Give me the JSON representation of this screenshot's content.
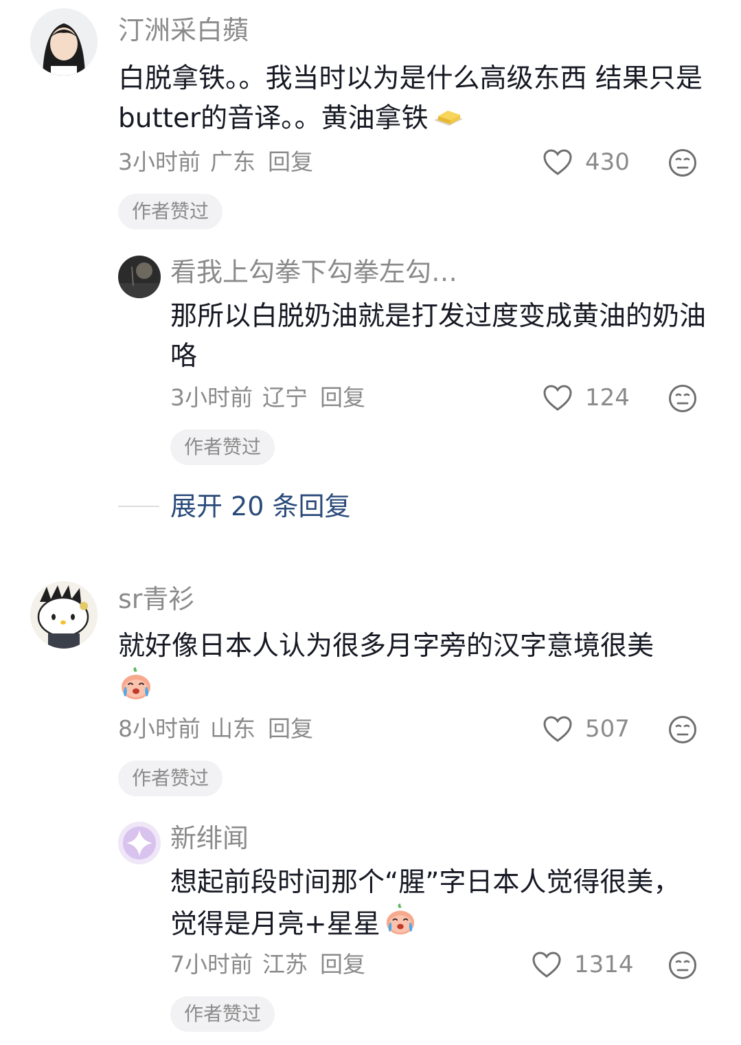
{
  "comments": [
    {
      "username": "汀洲采白蘋",
      "text": "白脱拿铁。。我当时以为是什么高级东西 结果只是butter的音译。。黄油拿铁",
      "time": "3小时前",
      "location": "广东",
      "reply_label": "回复",
      "likes": "430",
      "badge": "作者赞过",
      "reply": {
        "username": "看我上勾拳下勾拳左勾…",
        "text": "那所以白脱奶油就是打发过度变成黄油的奶油咯",
        "time": "3小时前",
        "location": "辽宁",
        "reply_label": "回复",
        "likes": "124",
        "badge": "作者赞过"
      },
      "expand_label": "展开 20 条回复"
    },
    {
      "username": "sr青衫",
      "text": "就好像日本人认为很多月字旁的汉字意境很美",
      "time": "8小时前",
      "location": "山东",
      "reply_label": "回复",
      "likes": "507",
      "badge": "作者赞过",
      "reply": {
        "username": "新绯闻",
        "text": "想起前段时间那个“腥”字日本人觉得很美，觉得是月亮+星星",
        "time": "7小时前",
        "location": "江苏",
        "reply_label": "回复",
        "likes": "1314",
        "badge": "作者赞过"
      }
    }
  ],
  "icons": {
    "like": "heart-outline-icon",
    "dislike": "meh-face-icon",
    "butter_emoji": "butter-emoji",
    "crying_emoji": "crying-peach-emoji"
  },
  "colors": {
    "text": "#161823",
    "muted": "#8a8a8a",
    "link": "#2a4a7a",
    "badge_bg": "#f2f2f4"
  }
}
